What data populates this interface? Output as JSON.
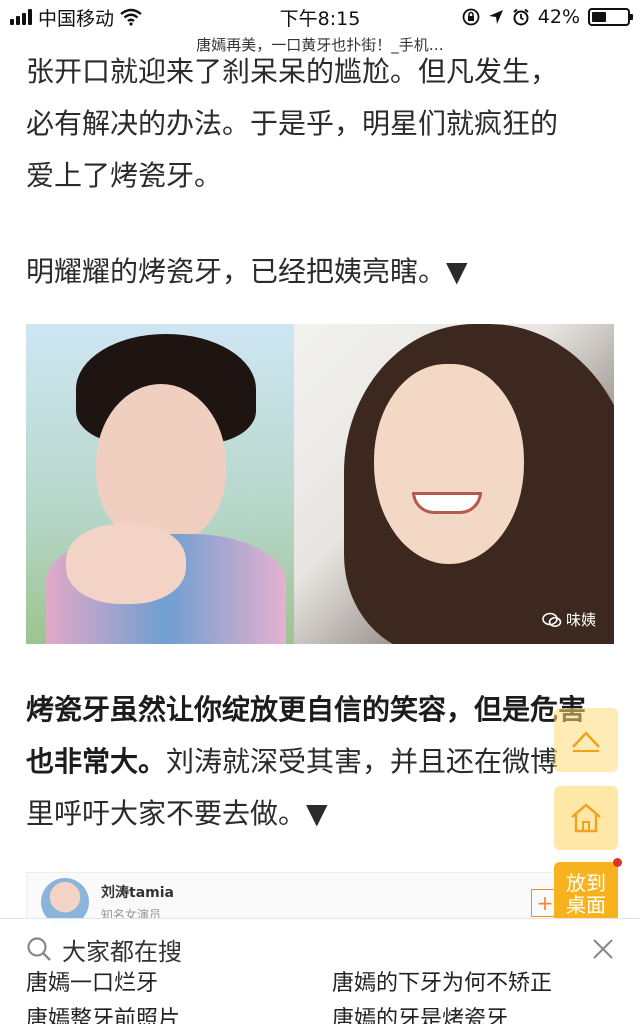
{
  "status_bar": {
    "carrier": "中国移动",
    "time": "下午8:15",
    "battery_percent": "42%",
    "battery_level": 0.42,
    "icons": [
      "signal-icon",
      "wifi-icon",
      "lock-rotation-icon",
      "location-icon",
      "alarm-icon",
      "battery-icon"
    ]
  },
  "page": {
    "title": "唐嫣再美，一口黄牙也扑街！_手机…"
  },
  "article": {
    "line_cut": "张开口就迎来了刹呆呆的尴尬。但凡发生，",
    "para1_line2": "必有解决的办法。于是乎，明星们就疯狂的",
    "para1_line3": "爱上了烤瓷牙。",
    "para2": "明耀耀的烤瓷牙，已经把姨亮瞎。▼",
    "photo_watermark": "味姨",
    "para3_bold": "烤瓷牙虽然让你绽放更自信的笑容，但是危害也非常大。",
    "para3_normal": "刘涛就深受其害，并且还在微博里呼吁大家不要去做。▼"
  },
  "weibo_card": {
    "name": "刘涛tamia",
    "subtitle": "知名女演员",
    "follow_symbol": "+"
  },
  "floating_buttons": {
    "desktop_label_line1": "放到",
    "desktop_label_line2": "桌面"
  },
  "search_panel": {
    "heading": "大家都在搜",
    "suggestions": [
      "唐嫣一口烂牙",
      "唐嫣的下牙为何不矫正",
      "唐嫣整牙前照片",
      "唐嫣的牙是烤瓷牙"
    ]
  },
  "colors": {
    "accent": "#f7b21e",
    "fab_light": "#ffdb78",
    "notification_dot": "#e0312a"
  }
}
